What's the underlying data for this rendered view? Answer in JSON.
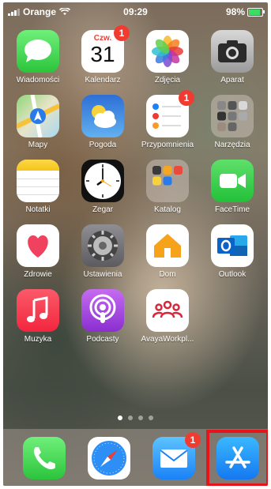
{
  "status": {
    "carrier": "Orange",
    "time": "09:29",
    "battery": "98%"
  },
  "apps": [
    {
      "id": "wiadomosci",
      "label": "Wiadomości",
      "icon": "messages-icon"
    },
    {
      "id": "kalendarz",
      "label": "Kalendarz",
      "icon": "calendar-icon",
      "day_name": "Czw.",
      "day_num": "31",
      "badge": "1"
    },
    {
      "id": "zdjecia",
      "label": "Zdjęcia",
      "icon": "photos-icon"
    },
    {
      "id": "aparat",
      "label": "Aparat",
      "icon": "camera-icon"
    },
    {
      "id": "mapy",
      "label": "Mapy",
      "icon": "maps-icon"
    },
    {
      "id": "pogoda",
      "label": "Pogoda",
      "icon": "weather-icon"
    },
    {
      "id": "przypomnienia",
      "label": "Przypomnienia",
      "icon": "reminders-icon",
      "badge": "1"
    },
    {
      "id": "narzedzia",
      "label": "Narzędzia",
      "icon": "folder-icon"
    },
    {
      "id": "notatki",
      "label": "Notatki",
      "icon": "notes-icon"
    },
    {
      "id": "zegar",
      "label": "Zegar",
      "icon": "clock-icon"
    },
    {
      "id": "katalog",
      "label": "Katalog",
      "icon": "folder-icon"
    },
    {
      "id": "facetime",
      "label": "FaceTime",
      "icon": "facetime-icon"
    },
    {
      "id": "zdrowie",
      "label": "Zdrowie",
      "icon": "health-icon"
    },
    {
      "id": "ustawienia",
      "label": "Ustawienia",
      "icon": "settings-icon"
    },
    {
      "id": "dom",
      "label": "Dom",
      "icon": "home-icon"
    },
    {
      "id": "outlook",
      "label": "Outlook",
      "icon": "outlook-icon"
    },
    {
      "id": "muzyka",
      "label": "Muzyka",
      "icon": "music-icon"
    },
    {
      "id": "podcasty",
      "label": "Podcasty",
      "icon": "podcasts-icon"
    },
    {
      "id": "avaya",
      "label": "AvayaWorkpl...",
      "icon": "avaya-icon"
    }
  ],
  "dock": [
    {
      "id": "telefon",
      "icon": "phone-icon"
    },
    {
      "id": "safari",
      "icon": "safari-icon"
    },
    {
      "id": "poczta",
      "icon": "mail-icon",
      "badge": "1"
    },
    {
      "id": "app-store",
      "icon": "app-store-icon"
    }
  ],
  "colors": {
    "highlight": "#e8141c",
    "badge": "#f23b30"
  }
}
